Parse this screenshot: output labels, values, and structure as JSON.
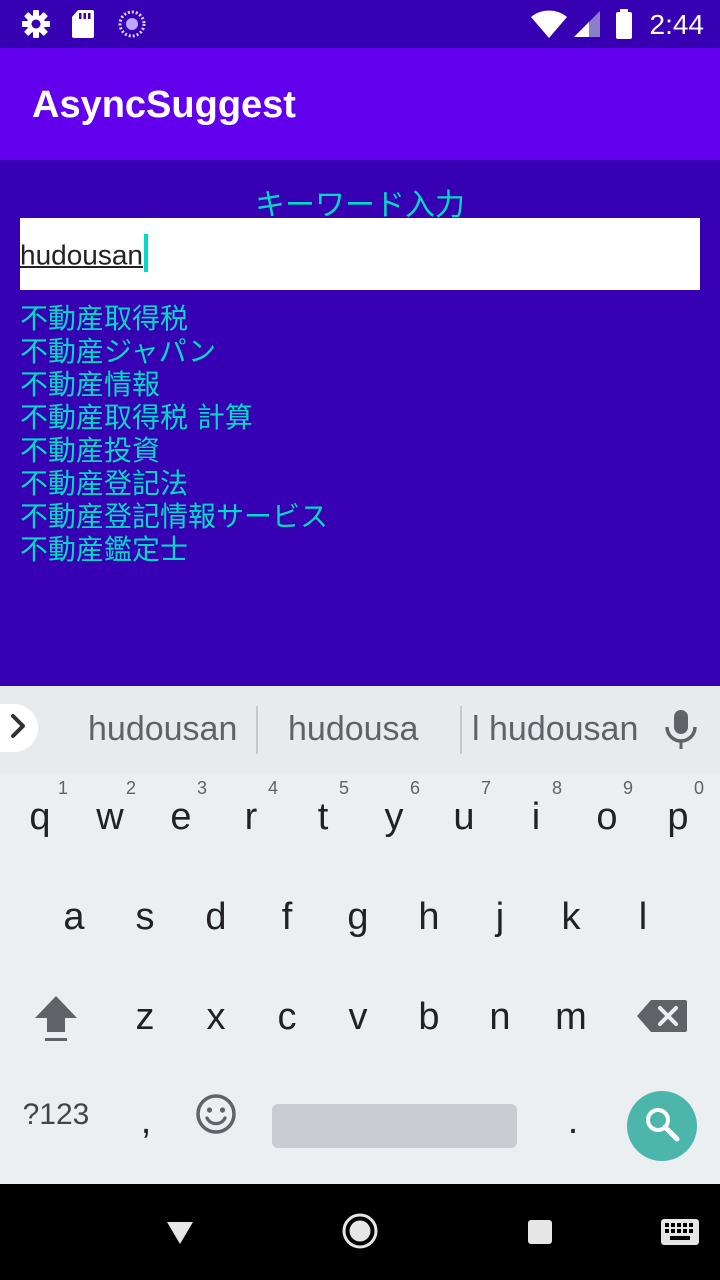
{
  "status_bar": {
    "time": "2:44",
    "icons": [
      "gear-icon",
      "sd-card-icon",
      "sync-icon",
      "wifi-icon",
      "signal-icon",
      "battery-icon"
    ]
  },
  "app_bar": {
    "title": "AsyncSuggest"
  },
  "form": {
    "label": "キーワード入力",
    "input_value": "hudousan"
  },
  "suggestions": [
    "不動産取得税",
    "不動産ジャパン",
    "不動産情報",
    "不動産取得税 計算",
    "不動産投資",
    "不動産登記法",
    "不動産登記情報サービス",
    "不動産鑑定士"
  ],
  "keyboard": {
    "suggestions": [
      "hudousan",
      "hudousa",
      "l hudousan"
    ],
    "row1": [
      "q",
      "w",
      "e",
      "r",
      "t",
      "y",
      "u",
      "i",
      "o",
      "p"
    ],
    "row1_hints": [
      "1",
      "2",
      "3",
      "4",
      "5",
      "6",
      "7",
      "8",
      "9",
      "0"
    ],
    "row2": [
      "a",
      "s",
      "d",
      "f",
      "g",
      "h",
      "j",
      "k",
      "l"
    ],
    "row3": [
      "z",
      "x",
      "c",
      "v",
      "b",
      "n",
      "m"
    ],
    "symbols_label": "?123",
    "comma": ",",
    "period": ".",
    "accent_color": "#4db6ac"
  },
  "colors": {
    "primary": "#6200ee",
    "primary_dark": "#3700b3",
    "accent": "#03dac5"
  }
}
